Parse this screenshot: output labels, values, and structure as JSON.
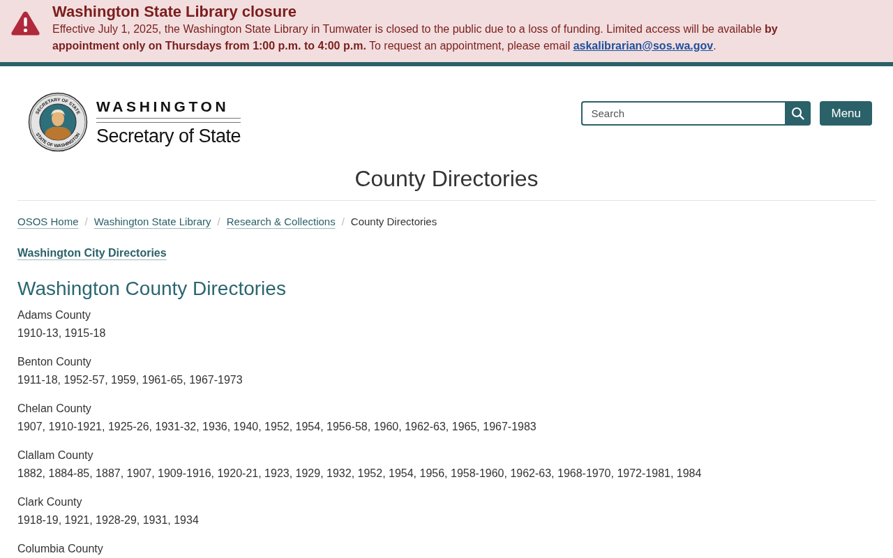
{
  "alert": {
    "title": "Washington State Library closure",
    "message": "Effective July 1, 2025, the Washington State Library in Tumwater is closed to the public due to a loss of funding. Limited access will be available **by appointment only on Thursdays from 1:00 p.m. to 4:00 p.m.** To request an appointment, please email",
    "email_link": "askalibrarian@sos.wa.gov",
    "message_end": "."
  },
  "header": {
    "logo": {
      "seal_top": "SECRETARY OF STATE",
      "seal_bottom": "STATE OF WASHINGTON",
      "wordmark_top": "WASHINGTON",
      "wordmark_bottom": "Secretary of State"
    },
    "search": {
      "placeholder": "Search"
    },
    "menu_button": "Menu"
  },
  "page_title": "County Directories",
  "breadcrumb": [
    {
      "kind": "link",
      "label": "OSOS Home"
    },
    {
      "kind": "separator",
      "label": "/"
    },
    {
      "kind": "link",
      "label": "Washington State Library"
    },
    {
      "kind": "separator",
      "label": "/"
    },
    {
      "kind": "link",
      "label": "Research & Collections"
    },
    {
      "kind": "separator",
      "label": "/"
    },
    {
      "kind": "current",
      "label": "County Directories"
    }
  ],
  "related_link": "Washington City Directories",
  "section_heading": "Washington County Directories",
  "counties": [
    {
      "name": "Adams County",
      "years": "1910-13, 1915-18"
    },
    {
      "name": "Benton County",
      "years": "1911-18, 1952-57, 1959, 1961-65, 1967-1973"
    },
    {
      "name": "Chelan County",
      "years": "1907, 1910-1921, 1925-26, 1931-32, 1936, 1940, 1952, 1954, 1956-58, 1960, 1962-63, 1965, 1967-1983"
    },
    {
      "name": "Clallam County",
      "years": "1882, 1884-85, 1887, 1907, 1909-1916, 1920-21, 1923, 1929, 1932, 1952, 1954, 1956, 1958-1960, 1962-63, 1968-1970, 1972-1981, 1984"
    },
    {
      "name": "Clark County",
      "years": "1918-19, 1921, 1928-29, 1931, 1934"
    },
    {
      "name": "Columbia County"
    }
  ]
}
